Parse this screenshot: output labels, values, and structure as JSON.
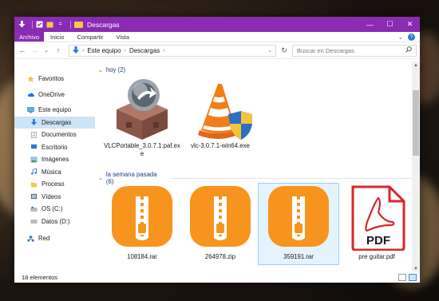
{
  "window": {
    "title": "Descargas",
    "minimize": "—",
    "maximize": "☐",
    "close": "✕"
  },
  "ribbon": {
    "file_tab": "Archivo",
    "tabs": [
      "Inicio",
      "Compartir",
      "Vista"
    ],
    "expand": "⌄",
    "help": "?"
  },
  "address": {
    "back": "←",
    "forward": "→",
    "recent": "⌄",
    "up": "↑",
    "path": [
      "Este equipo",
      "Descargas"
    ],
    "refresh": "↻",
    "search_placeholder": "Buscar en Descargas"
  },
  "nav": {
    "items": [
      {
        "label": "Favoritos",
        "icon": "star-icon"
      },
      {
        "label": "OneDrive",
        "icon": "cloud-icon"
      },
      {
        "label": "Este equipo",
        "icon": "computer-icon"
      },
      {
        "label": "Descargas",
        "icon": "download-icon",
        "selected": true
      },
      {
        "label": "Documentos",
        "icon": "document-icon"
      },
      {
        "label": "Escritorio",
        "icon": "desktop-icon"
      },
      {
        "label": "Imágenes",
        "icon": "pictures-icon"
      },
      {
        "label": "Música",
        "icon": "music-icon"
      },
      {
        "label": "Proceso",
        "icon": "folder-icon"
      },
      {
        "label": "Vídeos",
        "icon": "video-icon"
      },
      {
        "label": "OS (C:)",
        "icon": "drive-icon"
      },
      {
        "label": "Datos (D:)",
        "icon": "drive-icon"
      },
      {
        "label": "Red",
        "icon": "network-icon"
      }
    ]
  },
  "groups": [
    {
      "header": "hoy (2)",
      "files": [
        {
          "name": "VLCPortable_3.0.7.1.paf.exe",
          "name_line1": "VLCPortable_3.0.7.1.paf.ex",
          "name_line2": "e",
          "icon": "package-installer-icon"
        },
        {
          "name": "vlc-3.0.7.1-win64.exe",
          "icon": "vlc-cone-icon"
        }
      ]
    },
    {
      "header": "la semana pasada (6)",
      "files": [
        {
          "name": "108184.rar",
          "icon": "archive-icon"
        },
        {
          "name": "264978.zip",
          "icon": "archive-icon"
        },
        {
          "name": "359191.rar",
          "icon": "archive-icon"
        },
        {
          "name": "pre guitar.pdf",
          "icon": "pdf-icon",
          "badge": "PDF"
        }
      ]
    }
  ],
  "status": {
    "count": "18 elementos"
  },
  "colors": {
    "titlebar": "#8a2bb3",
    "selection": "#cce4f7",
    "archive": "#f7941d",
    "pdf_red": "#d9262b",
    "vlc_orange": "#f07f1a"
  }
}
